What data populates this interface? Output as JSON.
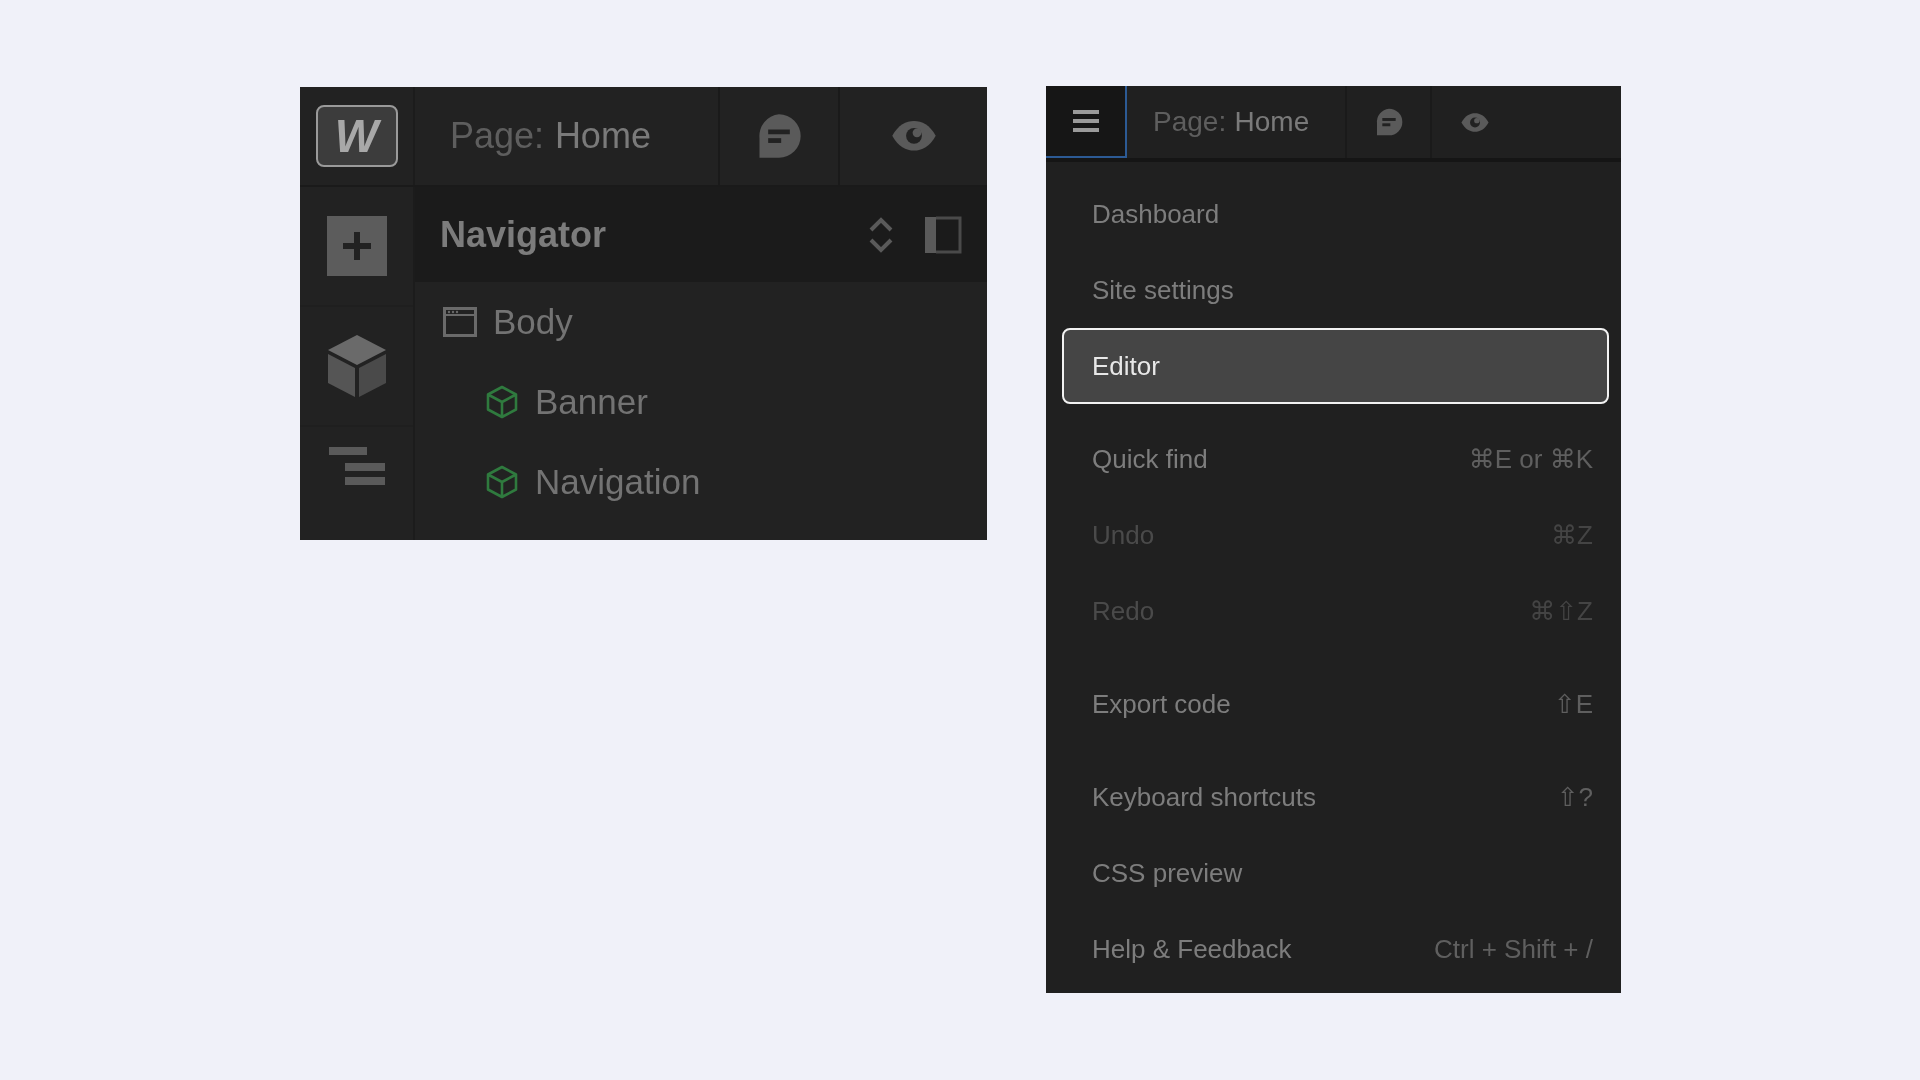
{
  "designer_panel": {
    "logo": "W",
    "page_label": "Page:",
    "page_name": "Home",
    "navigator": {
      "title": "Navigator",
      "tree": [
        {
          "label": "Body",
          "kind": "body",
          "children": [
            {
              "label": "Banner",
              "kind": "component"
            },
            {
              "label": "Navigation",
              "kind": "component"
            }
          ]
        }
      ]
    }
  },
  "menu_panel": {
    "menu_button": {
      "active": true
    },
    "page_label": "Page:",
    "page_name": "Home",
    "menu": [
      [
        {
          "label": "Dashboard",
          "selected": false,
          "disabled": false
        },
        {
          "label": "Site settings",
          "selected": false,
          "disabled": false
        },
        {
          "label": "Editor",
          "selected": true,
          "disabled": false
        }
      ],
      [
        {
          "label": "Quick find",
          "shortcut": "⌘E or ⌘K",
          "selected": false,
          "disabled": false
        },
        {
          "label": "Undo",
          "shortcut": "⌘Z",
          "selected": false,
          "disabled": true
        },
        {
          "label": "Redo",
          "shortcut": "⌘⇧Z",
          "selected": false,
          "disabled": true
        }
      ],
      [
        {
          "label": "Export code",
          "shortcut": "⇧E",
          "selected": false,
          "disabled": false
        }
      ],
      [
        {
          "label": "Keyboard shortcuts",
          "shortcut": "⇧?",
          "selected": false,
          "disabled": false
        },
        {
          "label": "CSS preview",
          "selected": false,
          "disabled": false
        },
        {
          "label": "Help & Feedback",
          "shortcut": "Ctrl + Shift + /",
          "selected": false,
          "disabled": false
        }
      ]
    ]
  }
}
